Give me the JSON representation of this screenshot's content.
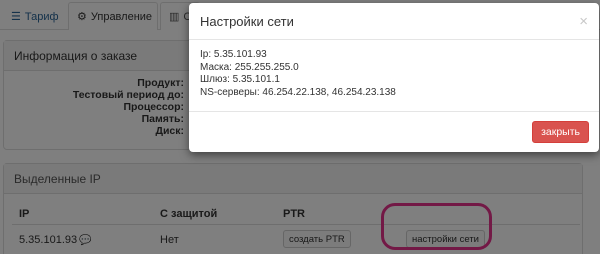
{
  "tabs": [
    {
      "label": "Тариф",
      "icon": "sliders-icon"
    },
    {
      "label": "Управление",
      "icon": "gear-icon"
    },
    {
      "label": "С",
      "icon": "chart-icon"
    }
  ],
  "order_panel": {
    "title": "Информация о заказе",
    "rows": [
      "Продукт:",
      "Тестовый период до:",
      "Процессор:",
      "Память:",
      "Диск:"
    ]
  },
  "ip_panel": {
    "title": "Выделенные IP",
    "columns": [
      "IP",
      "С защитой",
      "PTR"
    ],
    "rows": [
      {
        "ip": "5.35.101.93",
        "protected": "Нет",
        "ptr_button": "создать PTR",
        "settings_button": "настройки сети"
      }
    ]
  },
  "modal": {
    "title": "Настройки сети",
    "close_symbol": "×",
    "lines": [
      "Ip: 5.35.101.93",
      "Маска: 255.255.255.0",
      "Шлюз: 5.35.101.1",
      "NS-серверы: 46.254.22.138, 46.254.23.138"
    ],
    "close_button": "закрыть"
  },
  "colors": {
    "accent_link": "#2a6496",
    "danger_button": "#d9534f",
    "highlight": "#e6338d"
  }
}
